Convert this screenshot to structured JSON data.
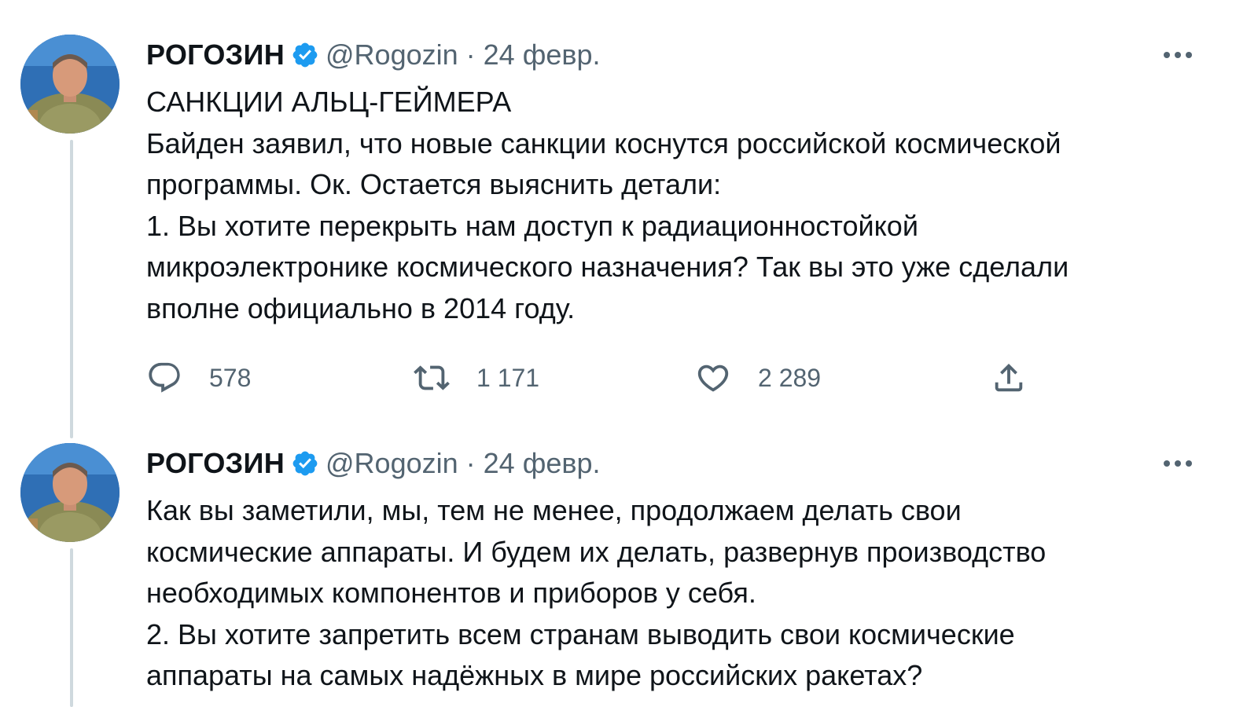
{
  "tweets": [
    {
      "author_name": "РОГОЗИН",
      "handle": "@Rogozin",
      "separator": "·",
      "date": "24 февр.",
      "lines": [
        "САНКЦИИ АЛЬЦ-ГЕЙМЕРА",
        "Байден заявил, что новые санкции коснутся российской космической",
        "программы. Ок. Остается выяснить детали:",
        "1. Вы хотите перекрыть нам доступ к радиационностойкой",
        "микроэлектронике космического назначения? Так вы это уже сделали",
        "вполне официально в 2014 году."
      ],
      "replies": "578",
      "retweets": "1 171",
      "likes": "2 289"
    },
    {
      "author_name": "РОГОЗИН",
      "handle": "@Rogozin",
      "separator": "·",
      "date": "24 февр.",
      "lines": [
        "Как вы заметили, мы, тем не менее, продолжаем делать свои",
        "космические аппараты. И будем их делать, развернув производство",
        "необходимых компонентов и приборов у себя.",
        "2. Вы хотите запретить всем странам выводить свои космические",
        "аппараты на самых надёжных в мире российских ракетах?"
      ]
    }
  ],
  "colors": {
    "text": "#0f1419",
    "secondary": "#536471",
    "verified": "#1d9bf0",
    "thread_line": "#cfd9de"
  },
  "icons": [
    "verified-badge-icon",
    "more-icon",
    "reply-icon",
    "retweet-icon",
    "like-icon",
    "share-icon"
  ]
}
